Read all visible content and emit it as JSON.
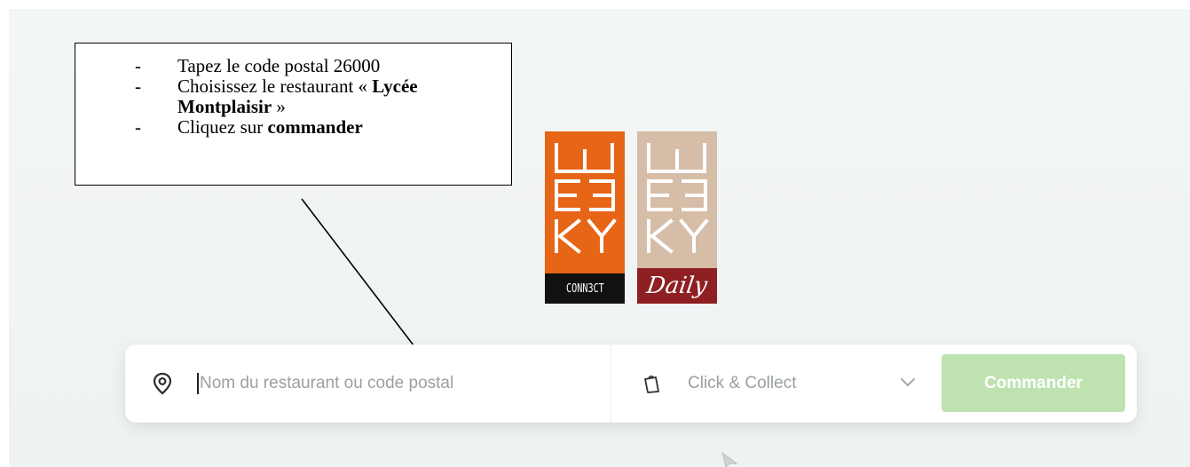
{
  "instructions": {
    "items": [
      {
        "dash": "-",
        "text_before": "Tapez le code postal 26000",
        "bold": "",
        "text_after": ""
      },
      {
        "dash": "-",
        "text_before": "Choisissez le restaurant «  ",
        "bold": "Lycée Montplaisir",
        "text_after": " »"
      },
      {
        "dash": "-",
        "text_before": "Cliquez sur ",
        "bold": "commander",
        "text_after": ""
      }
    ]
  },
  "logos": {
    "connect": {
      "name": "WEEKY",
      "tagline": "CONN3CT",
      "color": "#e66517",
      "tag_bg": "#111111"
    },
    "daily": {
      "name": "WEEKY",
      "tagline": "Daily",
      "color": "#d6bda8",
      "tag_bg": "#8e1f22"
    }
  },
  "search": {
    "icon": "location-pin-icon",
    "placeholder": "Nom du restaurant ou code postal",
    "value": ""
  },
  "mode": {
    "icon": "shopping-bag-icon",
    "selected": "Click & Collect",
    "chevron": "chevron-down-icon"
  },
  "order_button": {
    "label": "Commander",
    "color": "#bfe3b0"
  }
}
